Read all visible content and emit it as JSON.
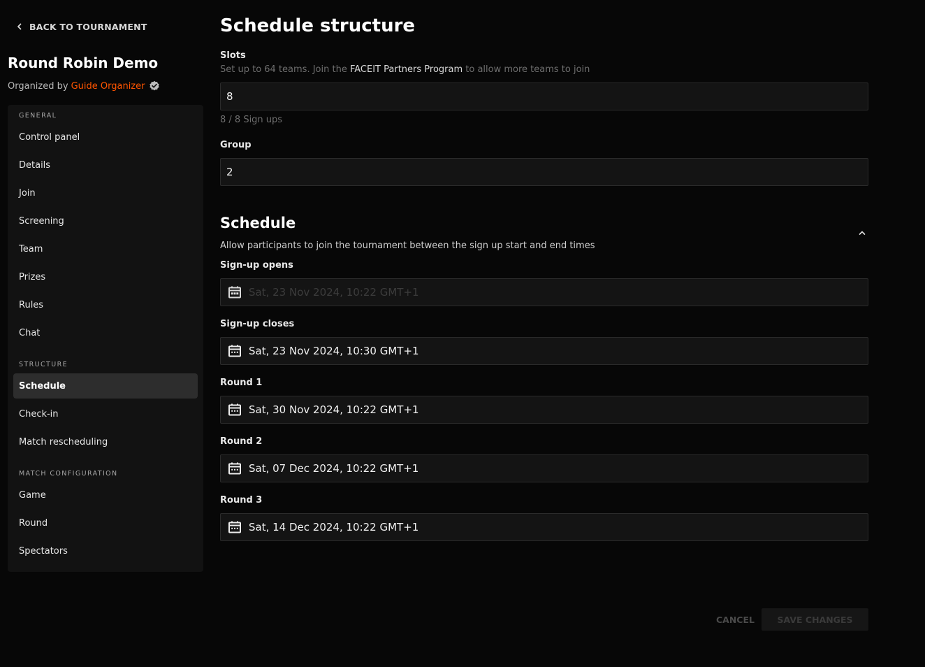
{
  "sidebar": {
    "back_label": "BACK TO TOURNAMENT",
    "tournament_title": "Round Robin Demo",
    "organized_by_label": "Organized by",
    "organizer_name": "Guide Organizer",
    "groups": [
      {
        "title": "GENERAL",
        "items": [
          "Control panel",
          "Details",
          "Join",
          "Screening",
          "Team",
          "Prizes",
          "Rules",
          "Chat"
        ]
      },
      {
        "title": "STRUCTURE",
        "items": [
          "Schedule",
          "Check-in",
          "Match rescheduling"
        ]
      },
      {
        "title": "MATCH CONFIGURATION",
        "items": [
          "Game",
          "Round",
          "Spectators"
        ]
      }
    ],
    "active_item": "Schedule"
  },
  "structure": {
    "title": "Schedule structure",
    "slots": {
      "label": "Slots",
      "hint_before": "Set up to 64 teams. Join the",
      "hint_link": "FACEIT Partners Program",
      "hint_after": "to allow more teams to join",
      "value": "8",
      "signups": "8 / 8 Sign ups"
    },
    "group": {
      "label": "Group",
      "value": "2"
    }
  },
  "schedule": {
    "title": "Schedule",
    "description": "Allow participants to join the tournament between the sign up start and end times",
    "signup_opens": {
      "label": "Sign-up opens",
      "value": "Sat, 23 Nov 2024, 10:22 GMT+1"
    },
    "signup_closes": {
      "label": "Sign-up closes",
      "value": "Sat, 23 Nov 2024, 10:30 GMT+1"
    },
    "round1": {
      "label": "Round 1",
      "value": "Sat, 30 Nov 2024, 10:22 GMT+1"
    },
    "round2": {
      "label": "Round 2",
      "value": "Sat, 07 Dec 2024, 10:22 GMT+1"
    },
    "round3": {
      "label": "Round 3",
      "value": "Sat, 14 Dec 2024, 10:22 GMT+1"
    }
  },
  "actions": {
    "cancel": "CANCEL",
    "save": "SAVE CHANGES"
  },
  "colors": {
    "accent_orange": "#ff5500",
    "background": "#070707",
    "panel": "#121212",
    "active_item_bg": "#2d2d2d"
  },
  "icons": {
    "back": "chevron-left-icon",
    "verified": "verified-badge-icon",
    "calendar": "calendar-icon",
    "collapse": "chevron-up-icon"
  }
}
